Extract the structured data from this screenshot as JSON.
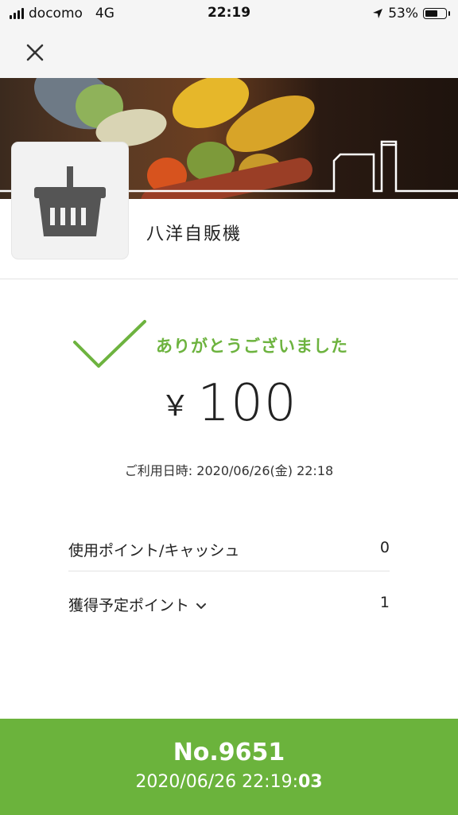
{
  "status_bar": {
    "carrier": "docomo",
    "network": "4G",
    "time": "22:19",
    "battery": "53%",
    "battery_level": 0.53
  },
  "nav": {
    "close_icon": "close-icon"
  },
  "shop": {
    "logo_icon": "basket-icon",
    "name": "八洋自販機"
  },
  "payment": {
    "thanks": "ありがとうございました",
    "currency": "￥",
    "amount": "100",
    "usage_date": "ご利用日時: 2020/06/26(金) 22:18"
  },
  "details": {
    "used_points_label": "使用ポイント/キャッシュ",
    "used_points_value": "0",
    "earned_points_label": "獲得予定ポイント",
    "earned_points_value": "1"
  },
  "footer": {
    "receipt_no": "No.9651",
    "time_main": "2020/06/26 22:19:",
    "time_seconds": "03"
  },
  "colors": {
    "accent_green": "#6bb33c",
    "check_green": "#6db33f"
  }
}
